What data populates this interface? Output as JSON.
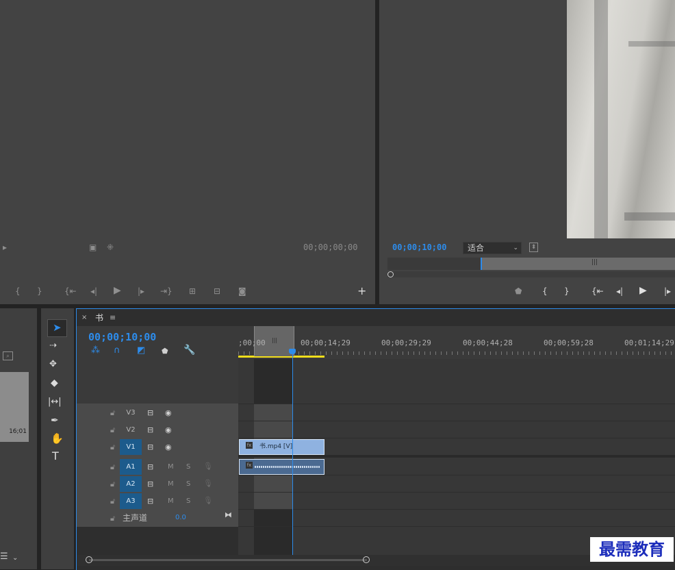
{
  "source_monitor": {
    "timecode": "00;00;00;00"
  },
  "program_monitor": {
    "timecode": "00;00;10;00",
    "fit_dropdown": "适合"
  },
  "project_panel": {
    "thumb_duration": "16;01"
  },
  "timeline": {
    "sequence_name": "书",
    "playhead_timecode": "00;00;10;00",
    "ruler_labels": [
      ";00;00",
      "00;00;14;29",
      "00;00;29;29",
      "00;00;44;28",
      "00;00;59;28",
      "00;01;14;29"
    ],
    "video_tracks": [
      "V3",
      "V2",
      "V1"
    ],
    "audio_tracks": [
      "A1",
      "A2",
      "A3"
    ],
    "mute_label": "M",
    "solo_label": "S",
    "master_label": "主声道",
    "master_value": "0.0",
    "clip_video_name": "书.mp4 [V]",
    "fx_label": "fx"
  },
  "watermark": "最需教育",
  "colors": {
    "accent_blue": "#2d8ceb",
    "track_target": "#1c5b8c",
    "clip_video": "#8fb2e0",
    "clip_audio": "#4b6a91",
    "work_area": "#f2de1b"
  }
}
